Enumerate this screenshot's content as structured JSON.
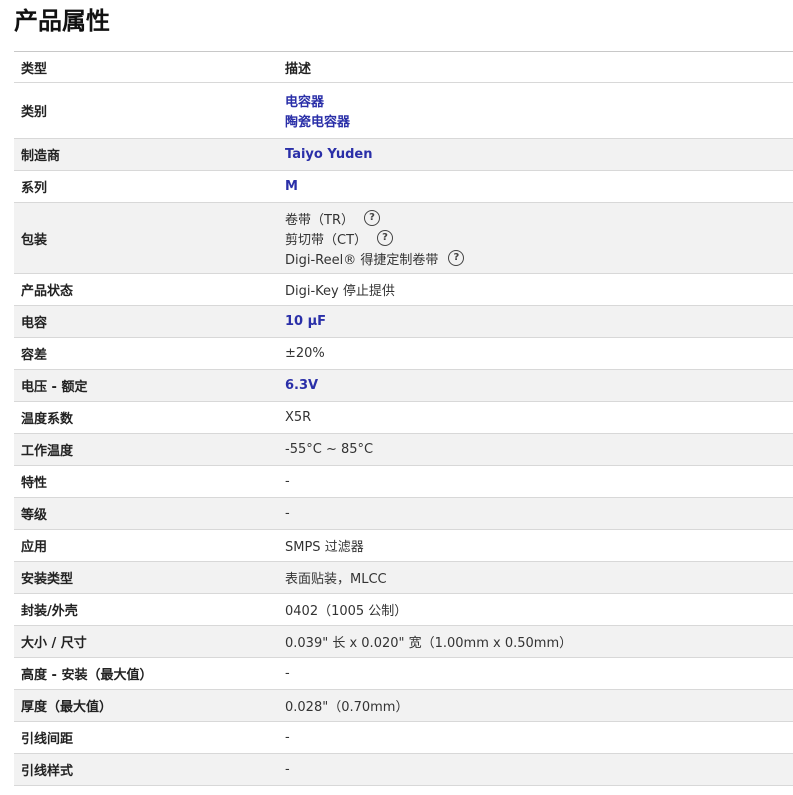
{
  "page_title": "产品属性",
  "header": {
    "label": "类型",
    "value": "描述"
  },
  "rows": [
    {
      "label": "类别",
      "values": [
        {
          "text": "电容器",
          "link": true
        },
        {
          "text": "陶瓷电容器",
          "link": true
        }
      ]
    },
    {
      "label": "制造商",
      "values": [
        {
          "text": "Taiyo Yuden",
          "link": true
        }
      ]
    },
    {
      "label": "系列",
      "values": [
        {
          "text": "M",
          "link": true
        }
      ]
    },
    {
      "label": "包装",
      "values": [
        {
          "text": "卷带（TR）",
          "help": true
        },
        {
          "text": "剪切带（CT）",
          "help": true
        },
        {
          "text": "Digi-Reel® 得捷定制卷带",
          "help": true
        }
      ]
    },
    {
      "label": "产品状态",
      "values": [
        {
          "text": "Digi-Key 停止提供"
        }
      ]
    },
    {
      "label": "电容",
      "values": [
        {
          "text": "10 µF",
          "link": true
        }
      ]
    },
    {
      "label": "容差",
      "values": [
        {
          "text": "±20%"
        }
      ]
    },
    {
      "label": "电压 - 额定",
      "values": [
        {
          "text": "6.3V",
          "link": true
        }
      ]
    },
    {
      "label": "温度系数",
      "values": [
        {
          "text": "X5R"
        }
      ]
    },
    {
      "label": "工作温度",
      "values": [
        {
          "text": "-55°C ~ 85°C"
        }
      ]
    },
    {
      "label": "特性",
      "values": [
        {
          "text": "-"
        }
      ]
    },
    {
      "label": "等级",
      "values": [
        {
          "text": "-"
        }
      ]
    },
    {
      "label": "应用",
      "values": [
        {
          "text": "SMPS 过滤器"
        }
      ]
    },
    {
      "label": "安装类型",
      "values": [
        {
          "text": "表面贴装，MLCC"
        }
      ]
    },
    {
      "label": "封装/外壳",
      "values": [
        {
          "text": "0402（1005 公制）"
        }
      ]
    },
    {
      "label": "大小 / 尺寸",
      "values": [
        {
          "text": "0.039\" 长 x 0.020\" 宽（1.00mm x 0.50mm）"
        }
      ]
    },
    {
      "label": "高度 - 安装（最大值）",
      "values": [
        {
          "text": "-"
        }
      ]
    },
    {
      "label": "厚度（最大值）",
      "values": [
        {
          "text": "0.028\"（0.70mm）"
        }
      ]
    },
    {
      "label": "引线间距",
      "values": [
        {
          "text": "-"
        }
      ]
    },
    {
      "label": "引线样式",
      "values": [
        {
          "text": "-"
        }
      ]
    }
  ],
  "icons": {
    "help": "question-circle-icon"
  },
  "colors": {
    "link": "#2a2fa8",
    "alt_row": "#f2f2f2",
    "border": "#d8d8d8"
  }
}
